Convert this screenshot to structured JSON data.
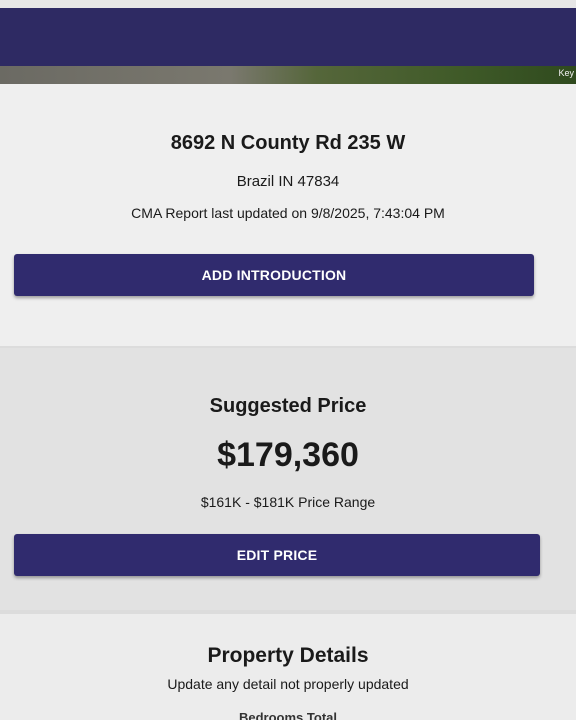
{
  "header": {
    "photo_label": "Key"
  },
  "address": {
    "street": "8692 N County Rd 235 W",
    "city_line": "Brazil IN 47834",
    "report_updated": "CMA Report last updated on 9/8/2025, 7:43:04 PM",
    "add_intro_label": "ADD INTRODUCTION"
  },
  "price": {
    "heading": "Suggested Price",
    "value": "$179,360",
    "range": "$161K - $181K Price Range",
    "edit_label": "EDIT PRICE"
  },
  "details": {
    "heading": "Property Details",
    "subtitle": "Update any detail not properly updated",
    "next_field": "Bedrooms Total"
  },
  "colors": {
    "brand": "#2e2a63",
    "button": "#302b6e"
  }
}
